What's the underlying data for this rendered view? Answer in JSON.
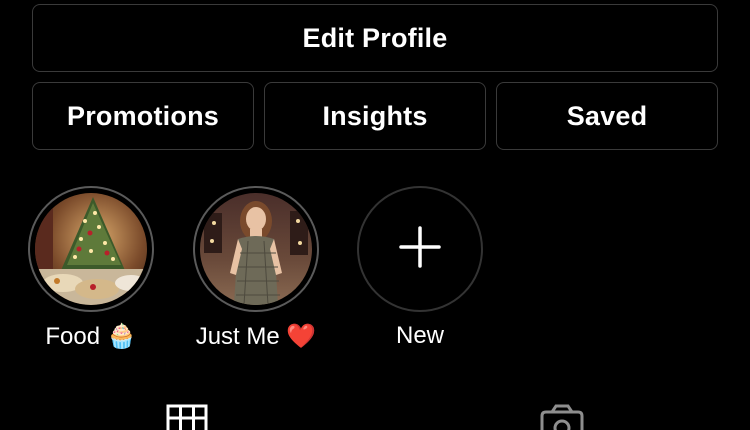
{
  "buttons": {
    "edit_profile": "Edit Profile",
    "promotions": "Promotions",
    "insights": "Insights",
    "saved": "Saved"
  },
  "highlights": [
    {
      "label": "Food 🧁",
      "image": "christmas-tree-food-photo"
    },
    {
      "label": "Just Me ❤️",
      "image": "person-portrait-photo"
    },
    {
      "label": "New",
      "icon": "plus-icon"
    }
  ],
  "tabs": [
    {
      "icon": "grid-icon",
      "selected": true
    },
    {
      "icon": "tagged-camera-icon",
      "selected": false
    }
  ],
  "colors": {
    "background": "#000000",
    "button_border": "#3a3a3a",
    "text": "#ffffff"
  }
}
